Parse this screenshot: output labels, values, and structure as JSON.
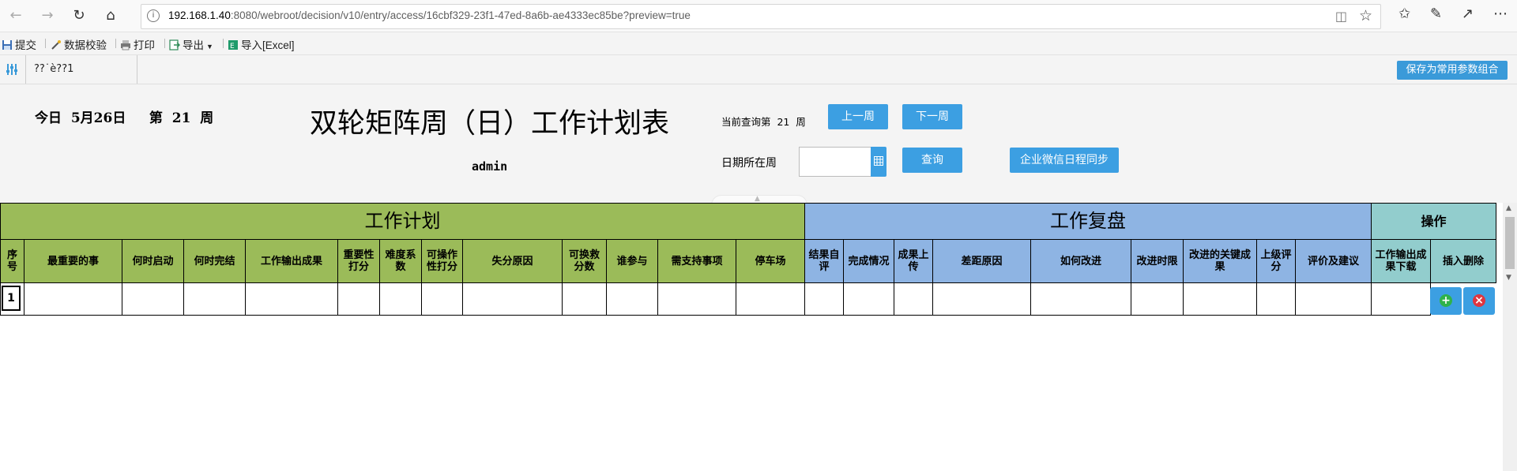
{
  "browser": {
    "url_host": "192.168.1.40",
    "url_rest": ":8080/webroot/decision/v10/entry/access/16cbf329-23f1-47ed-8a6b-ae4333ec85be?preview=true",
    "back_icon": "back-arrow-icon",
    "forward_icon": "forward-arrow-icon",
    "refresh_icon": "refresh-icon",
    "home_icon": "home-icon",
    "info_icon": "info-icon",
    "reader_icon": "reading-view-icon",
    "favorite_icon": "star-icon",
    "favorites_icon": "favorites-icon",
    "notes_icon": "pen-icon",
    "share_icon": "share-icon",
    "more_icon": "more-icon"
  },
  "toolbar": {
    "submit": "提交",
    "validate": "数据校验",
    "print": "打印",
    "export": "导出",
    "import_excel": "导入[Excel]"
  },
  "parambar": {
    "tab_label": "??˙è??1",
    "save_button": "保存为常用参数组合"
  },
  "params": {
    "today_text": "今日  5月26日     第  21  周",
    "title": "双轮矩阵周（日）工作计划表",
    "user": "admin",
    "current_week_text": "当前查询第  21  周",
    "prev_week": "上一周",
    "next_week": "下一周",
    "date_label": "日期所在周",
    "date_value": "",
    "query": "查询",
    "wechat_sync": "企业微信日程同步"
  },
  "table": {
    "group_plan": "工作计划",
    "group_review": "工作复盘",
    "group_ops": "操作",
    "plan_columns": [
      "序号",
      "最重要的事",
      "何时启动",
      "何时完结",
      "工作输出成果",
      "重要性打分",
      "难度系数",
      "可操作性打分",
      "失分原因",
      "可换救分数",
      "谁参与",
      "需支持事项",
      "停车场"
    ],
    "review_columns": [
      "结果自评",
      "完成情况",
      "成果上传",
      "差距原因",
      "如何改进",
      "改进时限",
      "改进的关键成果",
      "上级评分",
      "评价及建议"
    ],
    "ops_columns": [
      "工作输出成果下载",
      "插入删除"
    ],
    "rows": [
      {
        "no": "1"
      }
    ]
  },
  "colors": {
    "plan_green": "#9bbb59",
    "review_blue": "#8eb4e3",
    "ops_teal": "#92cdcd",
    "button_blue": "#3c9fe2"
  }
}
